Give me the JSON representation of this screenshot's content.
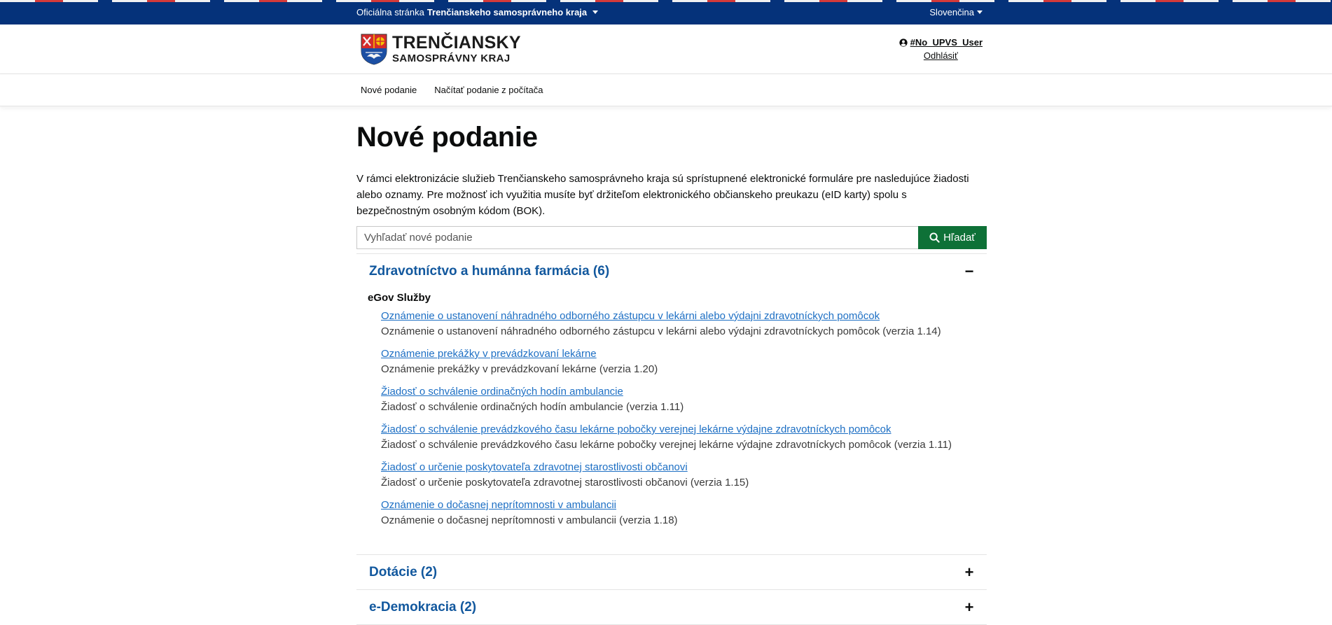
{
  "topbar": {
    "official_prefix": "Oficiálna stránka",
    "official_name": "Trenčianskeho samosprávneho kraja",
    "language": "Slovenčina"
  },
  "header": {
    "logo_line1": "TRENČIANSKY",
    "logo_line2": "SAMOSPRÁVNY KRAJ",
    "user_name": "#No_UPVS_User",
    "logout_label": "Odhlásiť"
  },
  "nav": {
    "items": [
      "Nové podanie",
      "Načítať podanie z počítača"
    ]
  },
  "main": {
    "title": "Nové podanie",
    "intro": "V rámci elektronizácie služieb Trenčianskeho samosprávneho kraja sú sprístupnené elektronické formuláre pre nasledujúce žiadosti alebo oznamy. Pre možnosť ich využitia musíte byť držiteľom elektronického občianskeho preukazu (eID karty) spolu s bezpečnostným osobným kódom (BOK).",
    "search": {
      "placeholder": "Vyhľadať nové podanie",
      "value": "",
      "button_label": "Hľadať"
    },
    "categories": [
      {
        "title": "Zdravotníctvo a humánna farmácia (6)",
        "expanded": true,
        "toggle": "−",
        "section": "eGov Služby",
        "services": [
          {
            "link": "Oznámenie o ustanovení náhradného odborného zástupcu v lekárni alebo výdajni zdravotníckych pomôcok",
            "desc": "Oznámenie o ustanovení náhradného odborného zástupcu v lekárni alebo výdajni zdravotníckych pomôcok (verzia 1.14)"
          },
          {
            "link": "Oznámenie prekážky v prevádzkovaní lekárne",
            "desc": "Oznámenie prekážky v prevádzkovaní lekárne (verzia 1.20)"
          },
          {
            "link": "Žiadosť o schválenie ordinačných hodín ambulancie",
            "desc": "Žiadosť o schválenie ordinačných hodín ambulancie (verzia 1.11)"
          },
          {
            "link": "Žiadosť o schválenie prevádzkového času lekárne pobočky verejnej lekárne výdajne zdravotníckych pomôcok",
            "desc": "Žiadosť o schválenie prevádzkového času lekárne pobočky verejnej lekárne výdajne zdravotníckych pomôcok (verzia 1.11)"
          },
          {
            "link": "Žiadosť o určenie poskytovateľa zdravotnej starostlivosti občanovi",
            "desc": "Žiadosť o určenie poskytovateľa zdravotnej starostlivosti občanovi (verzia 1.15)"
          },
          {
            "link": "Oznámenie o dočasnej neprítomnosti v ambulancii",
            "desc": "Oznámenie o dočasnej neprítomnosti v ambulancii (verzia 1.18)"
          }
        ]
      },
      {
        "title": "Dotácie (2)",
        "expanded": false,
        "toggle": "+"
      },
      {
        "title": "e-Demokracia (2)",
        "expanded": false,
        "toggle": "+"
      }
    ]
  },
  "colors": {
    "topbar": "#05327a",
    "search_button": "#0e7137",
    "category_title": "#12589e",
    "link": "#1d6fc4"
  },
  "icons": {
    "user": "user-circle-icon",
    "search": "search-icon",
    "collapse": "minus-icon",
    "expand": "plus-icon",
    "dropdown": "caret-down-icon"
  }
}
